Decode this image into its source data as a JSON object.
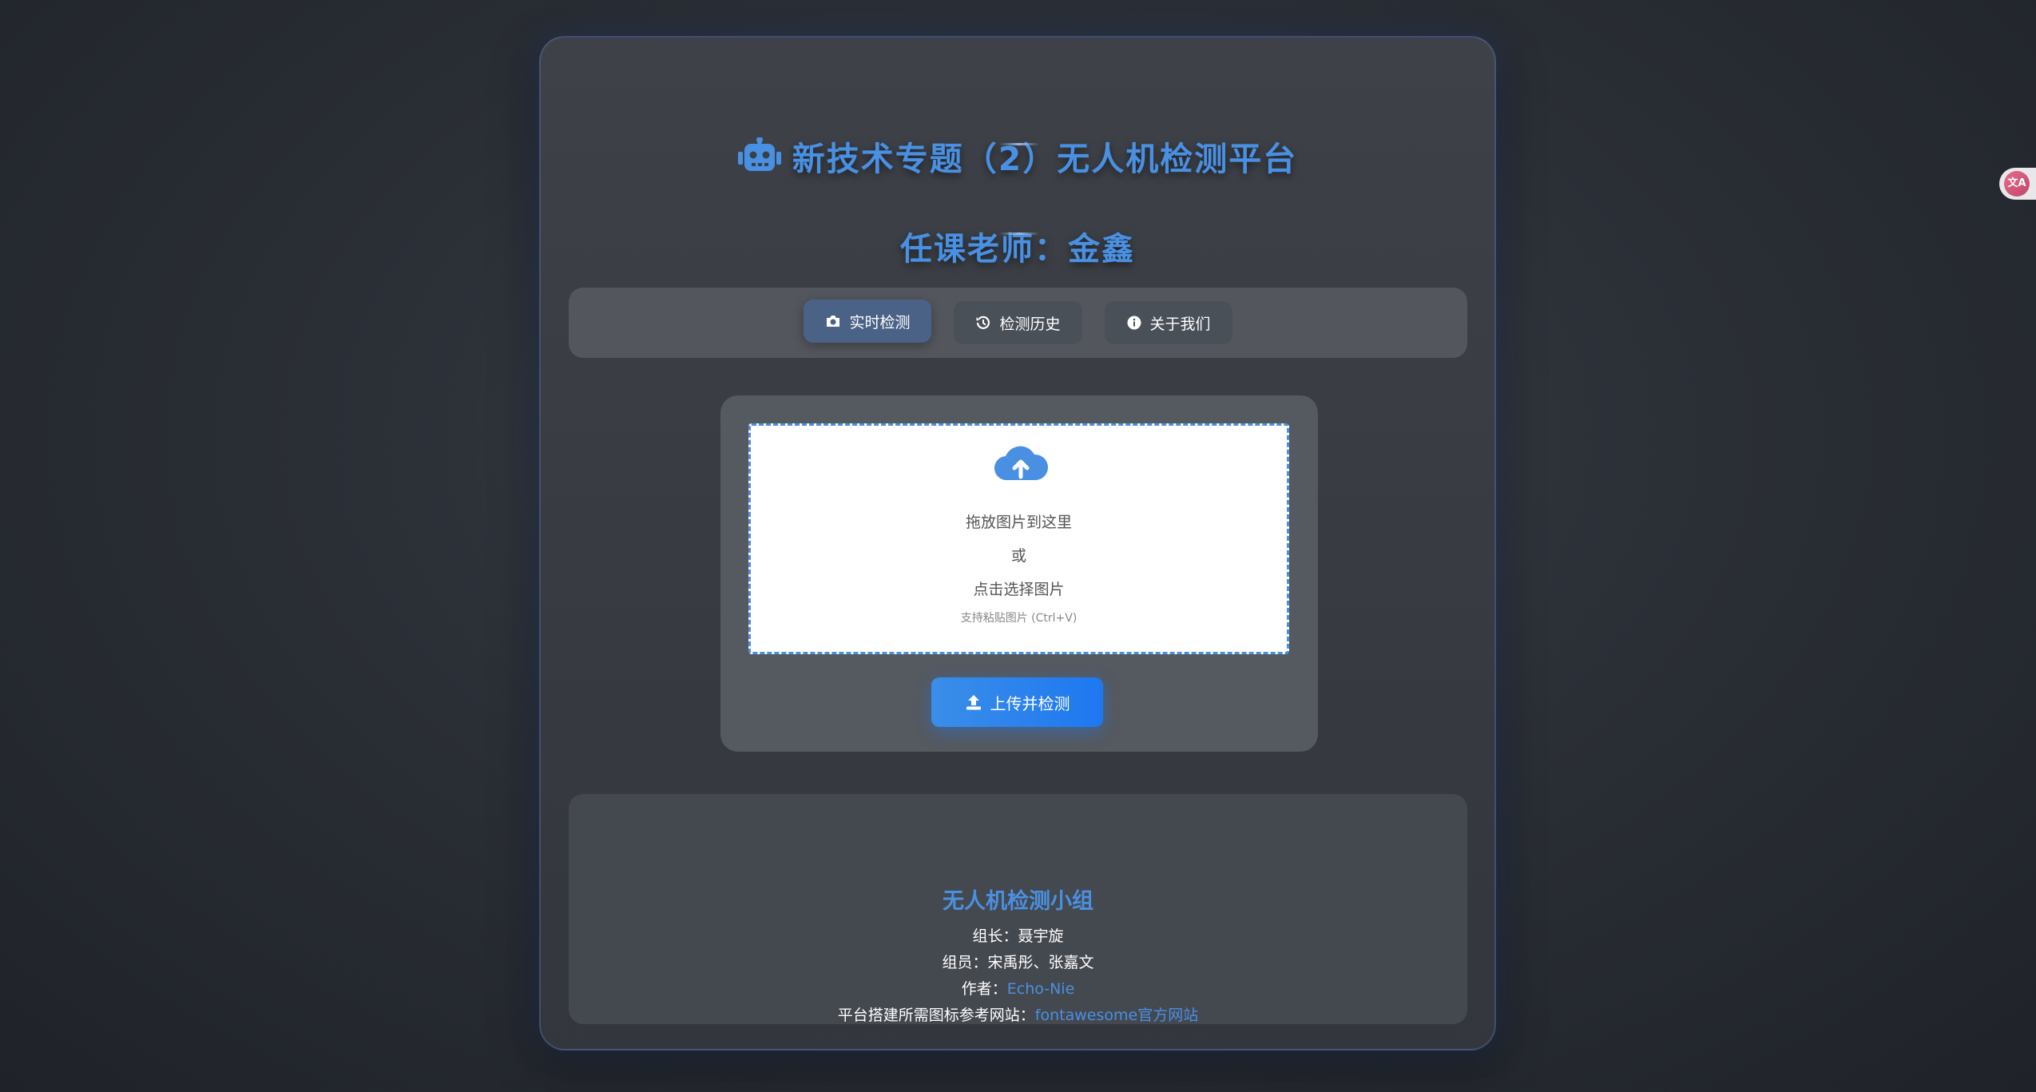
{
  "header": {
    "title": "新技术专题（2）无人机检测平台",
    "subtitle": "任课老师：金鑫",
    "title_icon": "robot-icon"
  },
  "nav": {
    "tabs": [
      {
        "label": "实时检测",
        "icon": "camera-icon",
        "active": true
      },
      {
        "label": "检测历史",
        "icon": "history-icon",
        "active": false
      },
      {
        "label": "关于我们",
        "icon": "info-circle-icon",
        "active": false
      }
    ]
  },
  "upload": {
    "cloud_icon": "cloud-upload-icon",
    "line1": "拖放图片到这里",
    "line2": "或",
    "line3": "点击选择图片",
    "hint": "支持粘贴图片 (Ctrl+V)",
    "button_label": "上传并检测",
    "button_icon": "upload-icon"
  },
  "footer": {
    "team_name": "无人机检测小组",
    "leader": "组长：聂宇旋",
    "members": "组员：宋禹彤、张嘉文",
    "author_label": "作者：",
    "author_link": "Echo-Nie",
    "ref_label": "平台搭建所需图标参考网站：",
    "ref_link": "fontawesome官方网站"
  },
  "side_widget": {
    "label": "文A",
    "icon": "translate-icon"
  },
  "colors": {
    "accent": "#4a90e2",
    "button": "#1e78f0",
    "background": "#2b2f36"
  }
}
